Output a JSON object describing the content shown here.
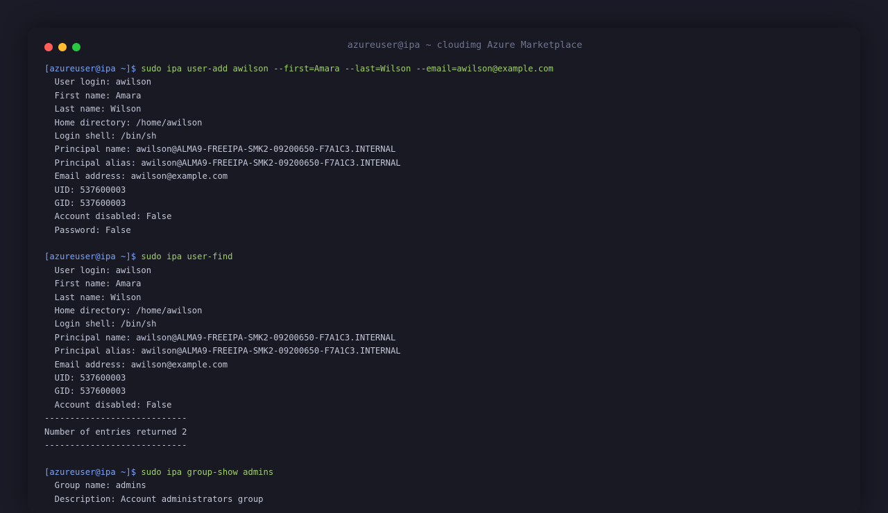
{
  "window": {
    "title": "azureuser@ipa ~ cloudimg Azure Marketplace",
    "colors": {
      "background": "#181922",
      "prompt": "#7aa2f7",
      "command": "#9ece6a",
      "output": "#c0c5d6",
      "close": "#ff5f57",
      "minimize": "#febc2e",
      "maximize": "#28c840"
    }
  },
  "terminal": {
    "lines": [
      {
        "type": "prompt",
        "prompt": "[azureuser@ipa ~]$ ",
        "command": "sudo ipa user-add awilson --first=Amara --last=Wilson --email=awilson@example.com"
      },
      {
        "type": "output",
        "text": "  User login: awilson"
      },
      {
        "type": "output",
        "text": "  First name: Amara"
      },
      {
        "type": "output",
        "text": "  Last name: Wilson"
      },
      {
        "type": "output",
        "text": "  Home directory: /home/awilson"
      },
      {
        "type": "output",
        "text": "  Login shell: /bin/sh"
      },
      {
        "type": "output",
        "text": "  Principal name: awilson@ALMA9-FREEIPA-SMK2-09200650-F7A1C3.INTERNAL"
      },
      {
        "type": "output",
        "text": "  Principal alias: awilson@ALMA9-FREEIPA-SMK2-09200650-F7A1C3.INTERNAL"
      },
      {
        "type": "output",
        "text": "  Email address: awilson@example.com"
      },
      {
        "type": "output",
        "text": "  UID: 537600003"
      },
      {
        "type": "output",
        "text": "  GID: 537600003"
      },
      {
        "type": "output",
        "text": "  Account disabled: False"
      },
      {
        "type": "output",
        "text": "  Password: False"
      },
      {
        "type": "output",
        "text": ""
      },
      {
        "type": "prompt",
        "prompt": "[azureuser@ipa ~]$ ",
        "command": "sudo ipa user-find"
      },
      {
        "type": "output",
        "text": "  User login: awilson"
      },
      {
        "type": "output",
        "text": "  First name: Amara"
      },
      {
        "type": "output",
        "text": "  Last name: Wilson"
      },
      {
        "type": "output",
        "text": "  Home directory: /home/awilson"
      },
      {
        "type": "output",
        "text": "  Login shell: /bin/sh"
      },
      {
        "type": "output",
        "text": "  Principal name: awilson@ALMA9-FREEIPA-SMK2-09200650-F7A1C3.INTERNAL"
      },
      {
        "type": "output",
        "text": "  Principal alias: awilson@ALMA9-FREEIPA-SMK2-09200650-F7A1C3.INTERNAL"
      },
      {
        "type": "output",
        "text": "  Email address: awilson@example.com"
      },
      {
        "type": "output",
        "text": "  UID: 537600003"
      },
      {
        "type": "output",
        "text": "  GID: 537600003"
      },
      {
        "type": "output",
        "text": "  Account disabled: False"
      },
      {
        "type": "output",
        "text": "----------------------------"
      },
      {
        "type": "output",
        "text": "Number of entries returned 2"
      },
      {
        "type": "output",
        "text": "----------------------------"
      },
      {
        "type": "output",
        "text": ""
      },
      {
        "type": "prompt",
        "prompt": "[azureuser@ipa ~]$ ",
        "command": "sudo ipa group-show admins"
      },
      {
        "type": "output",
        "text": "  Group name: admins"
      },
      {
        "type": "output",
        "text": "  Description: Account administrators group"
      }
    ]
  }
}
